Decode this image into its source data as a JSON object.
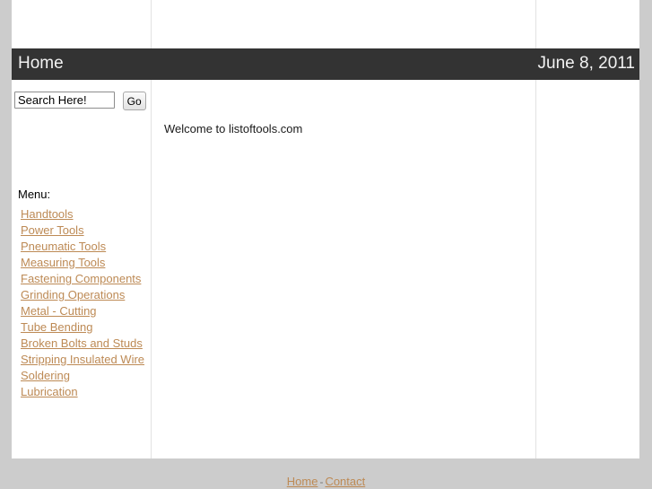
{
  "header": {
    "title": "Home",
    "date": "June 8, 2011"
  },
  "sidebar": {
    "search": {
      "value": "Search Here!",
      "placeholder": "Search Here!",
      "button_label": "Go"
    },
    "menu_heading": "Menu:",
    "menu_items": [
      {
        "label": "Handtools"
      },
      {
        "label": "Power Tools"
      },
      {
        "label": "Pneumatic Tools"
      },
      {
        "label": "Measuring Tools"
      },
      {
        "label": "Fastening Components"
      },
      {
        "label": "Grinding Operations"
      },
      {
        "label": "Metal - Cutting"
      },
      {
        "label": "Tube Bending"
      },
      {
        "label": "Broken Bolts and Studs"
      },
      {
        "label": "Stripping Insulated Wire"
      },
      {
        "label": "Soldering"
      },
      {
        "label": "Lubrication"
      }
    ]
  },
  "main": {
    "welcome": "Welcome to listoftools.com"
  },
  "footer": {
    "home_label": "Home",
    "separator": "-",
    "contact_label": "Contact"
  },
  "colors": {
    "link": "#bd8a55",
    "header_bg": "#333333",
    "page_bg": "#cccccc",
    "content_bg": "#ffffff",
    "divider": "#e2e2e2"
  }
}
